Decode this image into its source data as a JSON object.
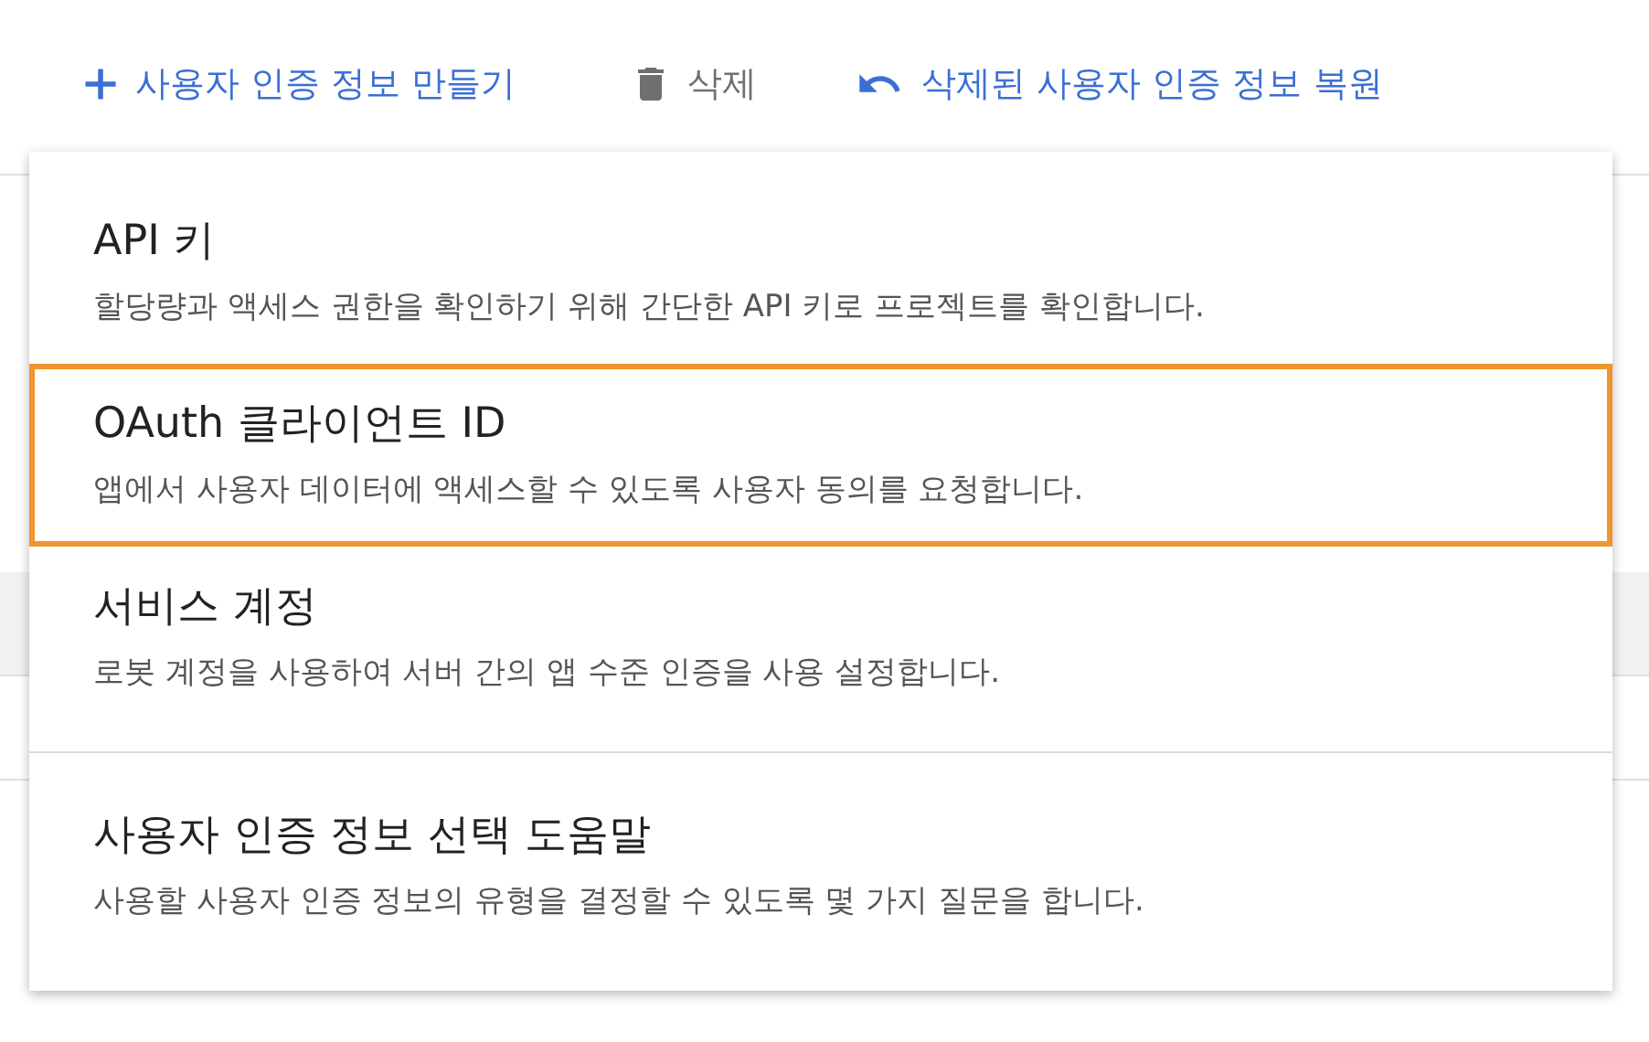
{
  "toolbar": [
    {
      "kind": "add",
      "label": "사용자 인증 정보 만들기",
      "disabled": false
    },
    {
      "kind": "delete",
      "label": "삭제",
      "disabled": true
    },
    {
      "kind": "restore",
      "label": "삭제된 사용자 인증 정보 복원",
      "disabled": false
    }
  ],
  "menu": {
    "items": [
      {
        "title": "API 키",
        "description": "할당량과 액세스 권한을 확인하기 위해 간단한 API 키로 프로젝트를 확인합니다.",
        "selected": false,
        "divider_before": false
      },
      {
        "title": "OAuth 클라이언트 ID",
        "description": "앱에서 사용자 데이터에 액세스할 수 있도록 사용자 동의를 요청합니다.",
        "selected": true,
        "divider_before": false
      },
      {
        "title": "서비스 계정",
        "description": "로봇 계정을 사용하여 서버 간의 앱 수준 인증을 사용 설정합니다.",
        "selected": false,
        "divider_before": false
      },
      {
        "title": "사용자 인증 정보 선택 도움말",
        "description": "사용할 사용자 인증 정보의 유형을 결정할 수 있도록 몇 가지 질문을 합니다.",
        "selected": false,
        "divider_before": true
      }
    ]
  }
}
